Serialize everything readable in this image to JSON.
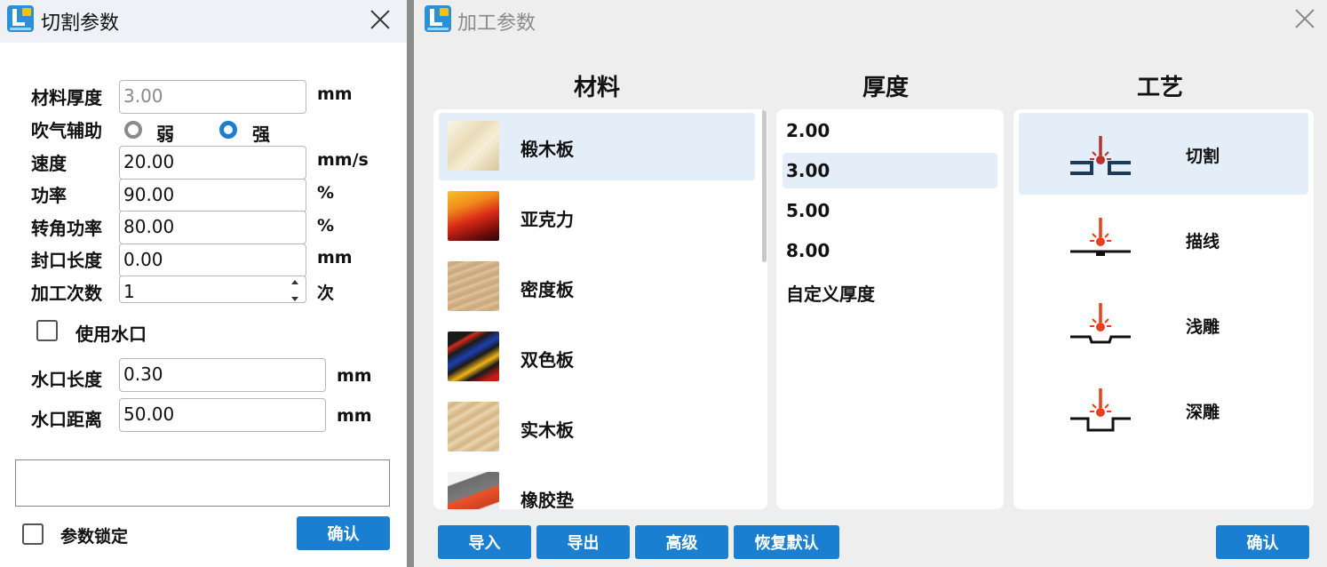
{
  "cut_dialog": {
    "title": "切割参数",
    "fields": {
      "thickness": {
        "label": "材料厚度",
        "value": "3.00",
        "unit": "mm"
      },
      "air_assist": {
        "label": "吹气辅助",
        "options": [
          "弱",
          "强"
        ],
        "selected": "强"
      },
      "speed": {
        "label": "速度",
        "value": "20.00",
        "unit": "mm/s"
      },
      "power": {
        "label": "功率",
        "value": "90.00",
        "unit": "%"
      },
      "corner_power": {
        "label": "转角功率",
        "value": "80.00",
        "unit": "%"
      },
      "seal_length": {
        "label": "封口长度",
        "value": "0.00",
        "unit": "mm"
      },
      "passes": {
        "label": "加工次数",
        "value": "1",
        "unit": "次"
      },
      "use_tab": {
        "label": "使用水口",
        "checked": false
      },
      "tab_length": {
        "label": "水口长度",
        "value": "0.30",
        "unit": "mm"
      },
      "tab_distance": {
        "label": "水口距离",
        "value": "50.00",
        "unit": "mm"
      }
    },
    "notes_value": "",
    "lock": {
      "label": "参数锁定",
      "checked": false
    },
    "confirm_label": "确认"
  },
  "process_dialog": {
    "title": "加工参数",
    "headers": {
      "material": "材料",
      "thickness": "厚度",
      "process": "工艺"
    },
    "materials": [
      {
        "name": "椴木板",
        "selected": true
      },
      {
        "name": "亚克力",
        "selected": false
      },
      {
        "name": "密度板",
        "selected": false
      },
      {
        "name": "双色板",
        "selected": false
      },
      {
        "name": "实木板",
        "selected": false
      },
      {
        "name": "橡胶垫",
        "selected": false
      }
    ],
    "thicknesses": [
      {
        "value": "2.00",
        "selected": false
      },
      {
        "value": "3.00",
        "selected": true
      },
      {
        "value": "5.00",
        "selected": false
      },
      {
        "value": "8.00",
        "selected": false
      },
      {
        "value": "自定义厚度",
        "selected": false
      }
    ],
    "processes": [
      {
        "name": "切割",
        "icon": "laser-cut-icon",
        "selected": true
      },
      {
        "name": "描线",
        "icon": "laser-line-icon",
        "selected": false
      },
      {
        "name": "浅雕",
        "icon": "laser-shallow-engrave-icon",
        "selected": false
      },
      {
        "name": "深雕",
        "icon": "laser-deep-engrave-icon",
        "selected": false
      }
    ],
    "buttons": {
      "import": "导入",
      "export": "导出",
      "advanced": "高级",
      "restore": "恢复默认",
      "confirm": "确认"
    }
  },
  "colors": {
    "accent": "#1a7fd0",
    "selected_bg": "#e3eef8",
    "laser_red": "#e8401c",
    "laser_dark_red": "#b8322f"
  }
}
